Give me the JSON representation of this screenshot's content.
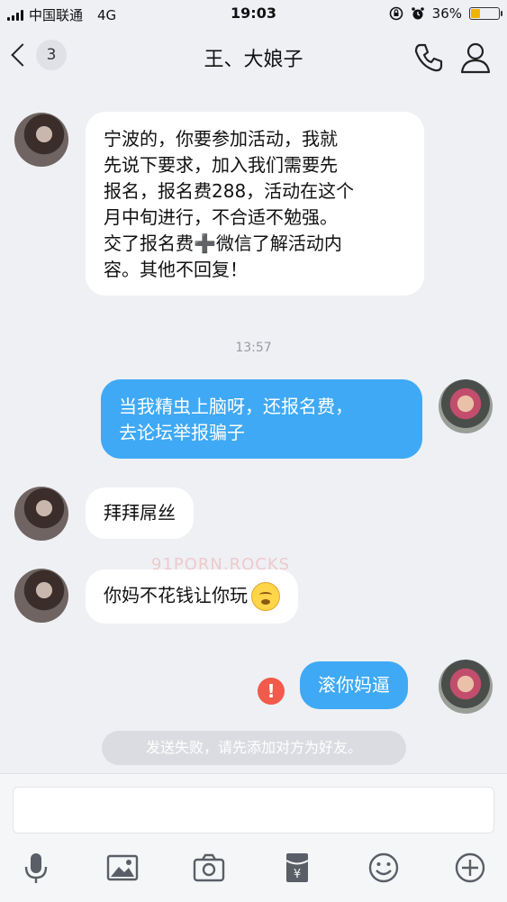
{
  "status_bar": {
    "carrier": "中国联通",
    "network": "4G",
    "time": "19:03",
    "battery_percent": "36%",
    "battery_level": 0.36
  },
  "nav": {
    "unread_count": "3",
    "title": "王、大娘子",
    "icons": [
      "back-chevron",
      "phone",
      "person"
    ]
  },
  "messages": [
    {
      "from": "them",
      "lines": [
        "宁波的，你要参加活动，我就",
        "先说下要求，加入我们需要先",
        "报名，报名费288，活动在这个",
        "月中旬进行，不合适不勉强。",
        "交了报名费➕微信了解活动内",
        "容。其他不回复！"
      ]
    },
    {
      "from": "me",
      "lines": [
        "当我精虫上脑呀，还报名费，",
        "去论坛举报骗子"
      ]
    },
    {
      "from": "them",
      "text": "拜拜屌丝"
    },
    {
      "from": "them",
      "text": "你妈不花钱让你玩",
      "emoji": "yawning-face"
    },
    {
      "from": "me",
      "text": "滚你妈逼",
      "status": "failed"
    }
  ],
  "timestamp": "13:57",
  "system_notice": "发送失败，请先添加对方为好友。",
  "watermark": "91PORN.ROCKS",
  "toolbar": [
    "microphone",
    "image",
    "camera",
    "red-packet",
    "emoji",
    "plus"
  ],
  "colors": {
    "outgoing": "#3fa9f5",
    "incoming": "#ffffff",
    "error": "#f25a4b",
    "battery": "#f0b400"
  }
}
